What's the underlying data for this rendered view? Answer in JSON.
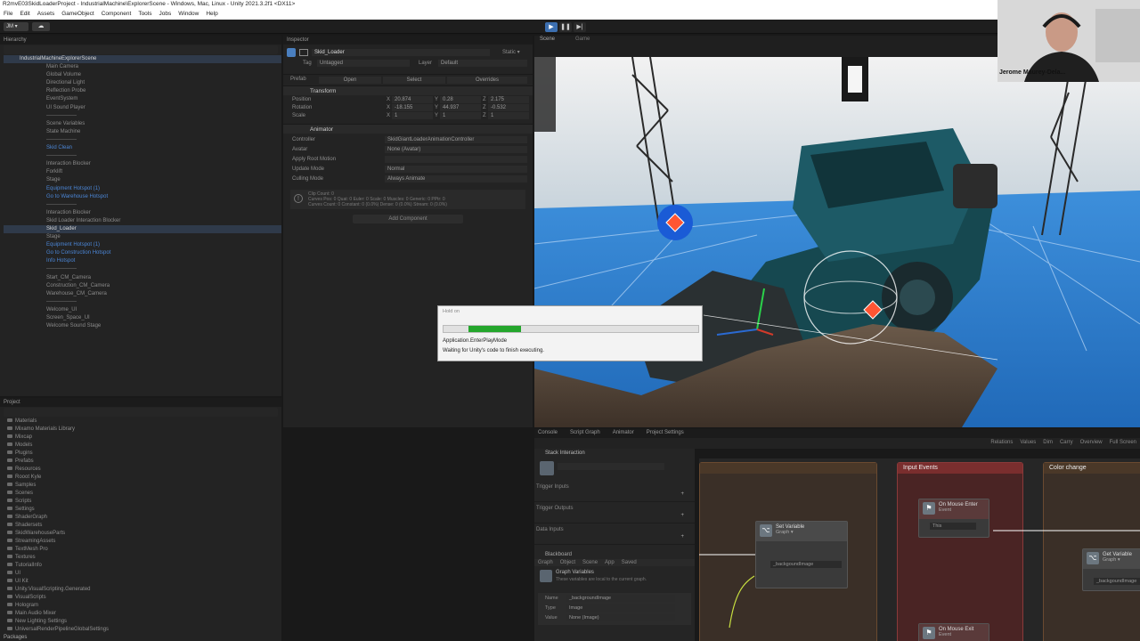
{
  "window": {
    "title": "R2mvE03SkidLoaderProject - IndustrialMachine\\ExplorerScene - Windows, Mac, Linux - Unity 2021.3.2f1 <DX11>"
  },
  "menu": [
    "File",
    "Edit",
    "Assets",
    "GameObject",
    "Component",
    "Tools",
    "Jobs",
    "Window",
    "Help"
  ],
  "toolbar": {
    "account": "JM ▾",
    "cloud_icon": "cloud-icon",
    "play": "▶",
    "pause": "❚❚",
    "step": "▶|"
  },
  "hierarchy": {
    "tab": "Hierarchy",
    "items": [
      {
        "label": "IndustrialMachineExplorerScene",
        "indent": 0,
        "style": "sel"
      },
      {
        "label": "Main Camera",
        "indent": 1
      },
      {
        "label": "Global Volume",
        "indent": 1
      },
      {
        "label": "Directional Light",
        "indent": 1
      },
      {
        "label": "Reflection Probe",
        "indent": 1
      },
      {
        "label": "EventSystem",
        "indent": 1
      },
      {
        "label": "UI Sound Player",
        "indent": 1
      },
      {
        "label": "-----------------",
        "indent": 1
      },
      {
        "label": "Scene Variables",
        "indent": 1
      },
      {
        "label": "State Machine",
        "indent": 1
      },
      {
        "label": "-----------------",
        "indent": 1
      },
      {
        "label": "Skid Clean",
        "indent": 1,
        "style": "blue"
      },
      {
        "label": "-----------------",
        "indent": 1
      },
      {
        "label": "Interaction Blocker",
        "indent": 1
      },
      {
        "label": "Forklift",
        "indent": 1
      },
      {
        "label": "Stage",
        "indent": 1
      },
      {
        "label": "Equipment Hotspot (1)",
        "indent": 1,
        "style": "blue"
      },
      {
        "label": "Go to Warehouse Hotspot",
        "indent": 1,
        "style": "blue"
      },
      {
        "label": "-----------------",
        "indent": 1
      },
      {
        "label": "Interaction Blocker",
        "indent": 1
      },
      {
        "label": "Skid Loader Interaction Blocker",
        "indent": 1
      },
      {
        "label": "Skid_Loader",
        "indent": 1,
        "style": "sel"
      },
      {
        "label": "Stage",
        "indent": 1
      },
      {
        "label": "Equipment Hotspot (1)",
        "indent": 1,
        "style": "blue"
      },
      {
        "label": "Go to Construction Hotspot",
        "indent": 1,
        "style": "blue"
      },
      {
        "label": "Info Hotspot",
        "indent": 1,
        "style": "blue"
      },
      {
        "label": "-----------------",
        "indent": 1
      },
      {
        "label": "Start_CM_Camera",
        "indent": 1
      },
      {
        "label": "Construction_CM_Camera",
        "indent": 1
      },
      {
        "label": "Warehouse_CM_Camera",
        "indent": 1
      },
      {
        "label": "-----------------",
        "indent": 1
      },
      {
        "label": "Welcome_UI",
        "indent": 1
      },
      {
        "label": "Screen_Space_UI",
        "indent": 1
      },
      {
        "label": "Welcome Sound Stage",
        "indent": 1
      }
    ]
  },
  "project": {
    "tab": "Project",
    "items": [
      "Materials",
      "Mixamo Materials Library",
      "Mixcap",
      "Models",
      "Plugins",
      "Prefabs",
      "Resources",
      "Rooot Kyle",
      "Samples",
      "Scenes",
      "Scripts",
      "Settings",
      "ShaderGraph",
      "Shadersets",
      "SkidWarehouseParts",
      "StreamingAssets",
      "TextMesh Pro",
      "Textures",
      "TutorialInfo",
      "UI",
      "UI Kit",
      "Unity.VisualScripting.Generated",
      "VisualScripts",
      "Hologram",
      "Main Audio Mixer",
      "New Lighting Settings",
      "UniversalRenderPipelineGlobalSettings"
    ],
    "packages": "Packages"
  },
  "inspector": {
    "tab": "Inspector",
    "object_name": "Skid_Loader",
    "static_label": "Static ▾",
    "tag_label": "Tag",
    "tag_value": "Untagged",
    "layer_label": "Layer",
    "layer_value": "Default",
    "prefab_label": "Prefab",
    "prefab_open": "Open",
    "prefab_select": "Select",
    "prefab_overrides": "Overrides",
    "transform": {
      "title": "Transform",
      "rows": [
        {
          "label": "Position",
          "x": "20.874",
          "y": "0.28",
          "z": "2.175"
        },
        {
          "label": "Rotation",
          "x": "-18.155",
          "y": "44.937",
          "z": "-0.532"
        },
        {
          "label": "Scale",
          "x": "1",
          "y": "1",
          "z": "1"
        }
      ]
    },
    "animator": {
      "title": "Animator",
      "rows": [
        {
          "label": "Controller",
          "value": "SkidGiantLoaderAnimationController"
        },
        {
          "label": "Avatar",
          "value": "None (Avatar)"
        },
        {
          "label": "Apply Root Motion",
          "value": ""
        },
        {
          "label": "Update Mode",
          "value": "Normal"
        },
        {
          "label": "Culling Mode",
          "value": "Always Animate"
        }
      ],
      "info_title": "Clip Count: 0",
      "info_line1": "Curves Pos: 0 Quat: 0 Euler: 0 Scale: 0 Muscles: 0 Generic: 0 PPtr: 0",
      "info_line2": "Curves Count: 0 Constant: 0 (0.0%) Dense: 0 (0.0%) Stream: 0 (0.0%)"
    },
    "add_component": "Add Component"
  },
  "scene_view": {
    "tab_scene": "Scene",
    "tab_game": "Game"
  },
  "dialog": {
    "title": "Hold on",
    "progress": 0.31,
    "step": "Application.EnterPlayMode",
    "message": "Waiting for Unity's code to finish executing."
  },
  "bottom_tabs": [
    "Console",
    "Script Graph",
    "Animator",
    "Project Settings"
  ],
  "graph_toolbar": [
    "Relations",
    "Values",
    "Dim",
    "Carry",
    "Overview",
    "Full Screen"
  ],
  "graph_inspector": {
    "title": "Stack Interaction",
    "sections": [
      "Trigger Inputs",
      "Trigger Outputs",
      "Data Inputs"
    ],
    "blackboard": "Blackboard",
    "bb_tabs": [
      "Graph",
      "Object",
      "Scene",
      "App",
      "Saved"
    ],
    "var_title": "Graph Variables",
    "var_desc": "These variables are local to the current graph.",
    "var_name_label": "Name",
    "var_name": "_backgroundImage",
    "var_type_label": "Type",
    "var_type": "Image",
    "var_value_label": "Value",
    "var_value": "None (Image)"
  },
  "graph": {
    "groups": [
      {
        "title": "Input Events",
        "color": "#6a2a2a"
      },
      {
        "title": "Color change",
        "color": "#4a3828"
      }
    ],
    "nodes": [
      {
        "title": "Set Variable",
        "sub": "Graph ▾",
        "field": "_backgoundImage"
      },
      {
        "title": "On Mouse Enter",
        "sub": "Event",
        "field": "This"
      },
      {
        "title": "Get Variable",
        "sub": "Graph ▾",
        "field": "_backgoundImage"
      },
      {
        "title": "On Mouse Exit",
        "sub": "Event",
        "field": ""
      }
    ]
  },
  "webcam": {
    "name": "Jerome Maurey-Dela..."
  },
  "colors": {
    "accent": "#3c6fb0",
    "progress": "#24a62c",
    "floor": "#2f7fcf",
    "machine": "#1d5a66"
  }
}
